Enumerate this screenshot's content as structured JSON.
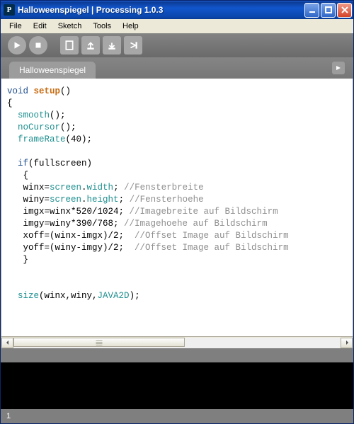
{
  "window": {
    "title": "Halloweenspiegel  |  Processing 1.0.3",
    "app_icon_letter": "P"
  },
  "menubar": {
    "items": [
      "File",
      "Edit",
      "Sketch",
      "Tools",
      "Help"
    ]
  },
  "tabs": {
    "active": "Halloweenspiegel"
  },
  "statusbar": {
    "line": "1"
  },
  "code": {
    "lines": [
      [
        {
          "t": "void ",
          "c": "kw-blue"
        },
        {
          "t": "setup",
          "c": "kw-orange"
        },
        {
          "t": "()",
          "c": ""
        }
      ],
      [
        {
          "t": "{",
          "c": ""
        }
      ],
      [
        {
          "t": "  ",
          "c": ""
        },
        {
          "t": "smooth",
          "c": "kw-teal"
        },
        {
          "t": "();",
          "c": ""
        }
      ],
      [
        {
          "t": "  ",
          "c": ""
        },
        {
          "t": "noCursor",
          "c": "kw-teal"
        },
        {
          "t": "();",
          "c": ""
        }
      ],
      [
        {
          "t": "  ",
          "c": ""
        },
        {
          "t": "frameRate",
          "c": "kw-teal"
        },
        {
          "t": "(40);",
          "c": ""
        }
      ],
      [
        {
          "t": "",
          "c": ""
        }
      ],
      [
        {
          "t": "  ",
          "c": ""
        },
        {
          "t": "if",
          "c": "kw-blue"
        },
        {
          "t": "(fullscreen)",
          "c": ""
        }
      ],
      [
        {
          "t": "   {",
          "c": ""
        }
      ],
      [
        {
          "t": "   winx=",
          "c": ""
        },
        {
          "t": "screen",
          "c": "kw-teal"
        },
        {
          "t": ".",
          "c": ""
        },
        {
          "t": "width",
          "c": "kw-teal"
        },
        {
          "t": "; ",
          "c": ""
        },
        {
          "t": "//Fensterbreite",
          "c": "cm"
        }
      ],
      [
        {
          "t": "   winy=",
          "c": ""
        },
        {
          "t": "screen",
          "c": "kw-teal"
        },
        {
          "t": ".",
          "c": ""
        },
        {
          "t": "height",
          "c": "kw-teal"
        },
        {
          "t": "; ",
          "c": ""
        },
        {
          "t": "//Fensterhoehe",
          "c": "cm"
        }
      ],
      [
        {
          "t": "   imgx=winx*520/1024; ",
          "c": ""
        },
        {
          "t": "//Imagebreite auf Bildschirm",
          "c": "cm"
        }
      ],
      [
        {
          "t": "   imgy=winy*390/768; ",
          "c": ""
        },
        {
          "t": "//Imagehoehe auf Bildschirm",
          "c": "cm"
        }
      ],
      [
        {
          "t": "   xoff=(winx-imgx)/2;  ",
          "c": ""
        },
        {
          "t": "//Offset Image auf Bildschirm",
          "c": "cm"
        }
      ],
      [
        {
          "t": "   yoff=(winy-imgy)/2;  ",
          "c": ""
        },
        {
          "t": "//Offset Image auf Bildschirm",
          "c": "cm"
        }
      ],
      [
        {
          "t": "   }",
          "c": ""
        }
      ],
      [
        {
          "t": "",
          "c": ""
        }
      ],
      [
        {
          "t": "",
          "c": ""
        }
      ],
      [
        {
          "t": "  ",
          "c": ""
        },
        {
          "t": "size",
          "c": "kw-teal"
        },
        {
          "t": "(winx,winy,",
          "c": ""
        },
        {
          "t": "JAVA2D",
          "c": "kw-teal"
        },
        {
          "t": ");",
          "c": ""
        }
      ]
    ]
  }
}
